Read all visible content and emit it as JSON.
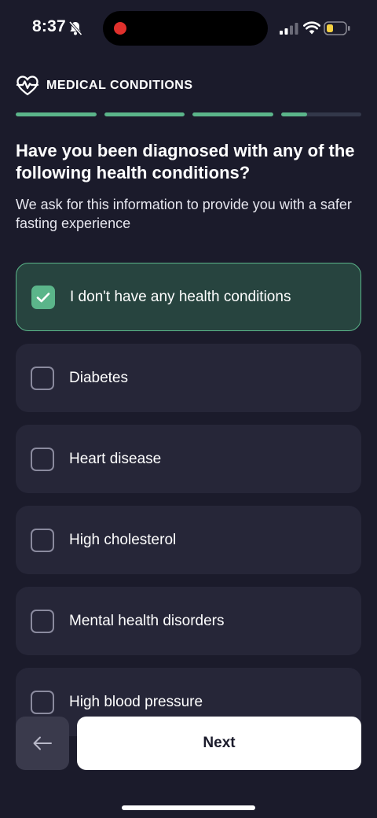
{
  "status_bar": {
    "time": "8:37",
    "icons": [
      "bell-slash-icon",
      "recording-dot-icon",
      "cellular-signal-icon",
      "wifi-icon",
      "battery-low-icon"
    ],
    "battery_color": "#f5d142",
    "recording_color": "#e0302c"
  },
  "header": {
    "icon": "heartbeat-icon",
    "title": "MEDICAL CONDITIONS"
  },
  "progress": {
    "segments": [
      1,
      1,
      1,
      0.33
    ],
    "color": "#5bb58a"
  },
  "question": {
    "title": "Have you been diagnosed with any of the following health conditions?",
    "subtitle": "We ask for this information to provide you with a safer fasting experience"
  },
  "options": [
    {
      "label": "I don't have any health conditions",
      "checked": true
    },
    {
      "label": "Diabetes",
      "checked": false
    },
    {
      "label": "Heart disease",
      "checked": false
    },
    {
      "label": "High cholesterol",
      "checked": false
    },
    {
      "label": "Mental health disorders",
      "checked": false
    },
    {
      "label": "High blood pressure",
      "checked": false
    }
  ],
  "footer": {
    "back_icon": "arrow-left-icon",
    "next_label": "Next"
  },
  "colors": {
    "background": "#1b1b2b",
    "card": "#262638",
    "accent": "#5bb58a",
    "selected_card": "#27443f"
  }
}
